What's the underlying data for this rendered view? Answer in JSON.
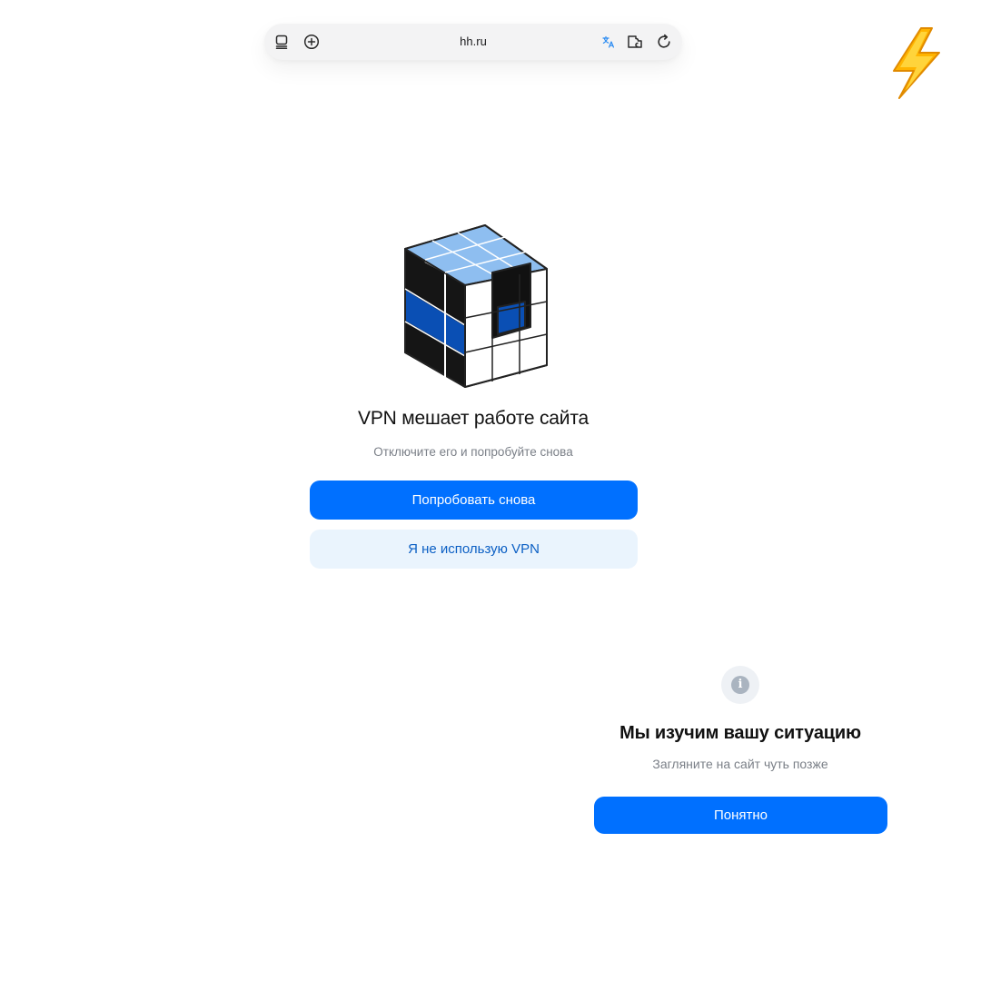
{
  "browser": {
    "url": "hh.ru",
    "icons": [
      "tabs-icon",
      "new-tab-icon",
      "translate-icon",
      "extension-icon",
      "reload-icon"
    ]
  },
  "decor": {
    "emoji": "high-voltage-emoji"
  },
  "vpn_dialog": {
    "title": "VPN мешает работе сайта",
    "subtitle": "Отключите его и попробуйте снова",
    "retry_label": "Попробовать снова",
    "no_vpn_label": "Я не использую VPN",
    "illustration": "rubik-cube-illustration"
  },
  "info_dialog": {
    "icon_glyph": "i",
    "title": "Мы изучим вашу ситуацию",
    "subtitle": "Загляните на сайт чуть позже",
    "ok_label": "Понятно"
  },
  "colors": {
    "primary": "#0070ff",
    "secondary_bg": "#eaf4fd",
    "secondary_text": "#0b5fc4",
    "muted_text": "#7a7f87",
    "cube_light_blue": "#8ebef0",
    "cube_dark_blue": "#0a4fb4"
  }
}
